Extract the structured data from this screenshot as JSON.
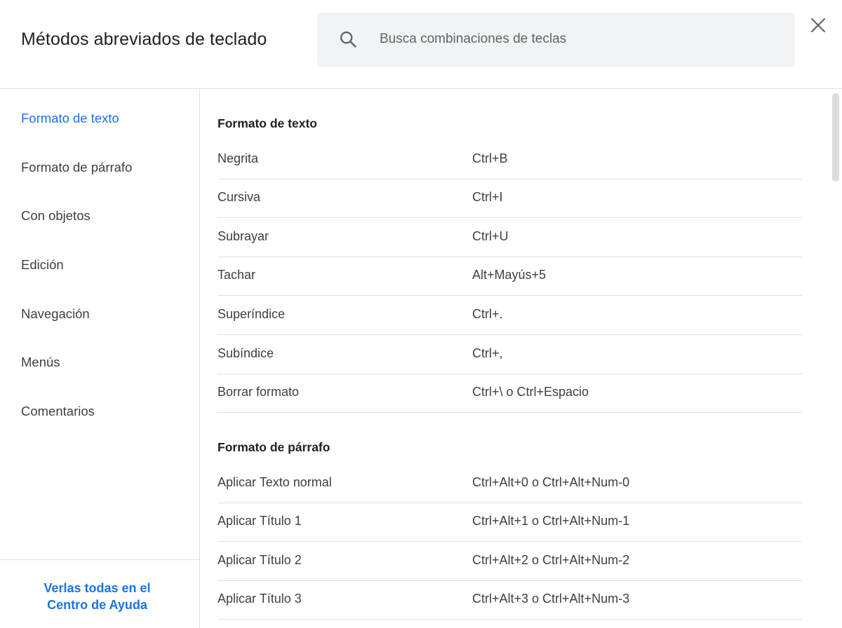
{
  "header": {
    "title": "Métodos abreviados de teclado",
    "search_placeholder": "Busca combinaciones de teclas",
    "search_icon": "search-icon",
    "close_icon": "close-icon"
  },
  "sidebar": {
    "items": [
      {
        "label": "Formato de texto",
        "active": true
      },
      {
        "label": "Formato de párrafo",
        "active": false
      },
      {
        "label": "Con objetos",
        "active": false
      },
      {
        "label": "Edición",
        "active": false
      },
      {
        "label": "Navegación",
        "active": false
      },
      {
        "label": "Menús",
        "active": false
      },
      {
        "label": "Comentarios",
        "active": false
      }
    ],
    "help_link_line1": "Verlas todas en el",
    "help_link_line2": "Centro de Ayuda"
  },
  "sections": [
    {
      "title": "Formato de texto",
      "rows": [
        {
          "action": "Negrita",
          "keys": "Ctrl+B"
        },
        {
          "action": "Cursiva",
          "keys": "Ctrl+I"
        },
        {
          "action": "Subrayar",
          "keys": "Ctrl+U"
        },
        {
          "action": "Tachar",
          "keys": "Alt+Mayús+5"
        },
        {
          "action": "Superíndice",
          "keys": "Ctrl+."
        },
        {
          "action": "Subíndice",
          "keys": "Ctrl+,"
        },
        {
          "action": "Borrar formato",
          "keys": "Ctrl+\\ o Ctrl+Espacio"
        }
      ]
    },
    {
      "title": "Formato de párrafo",
      "rows": [
        {
          "action": "Aplicar Texto normal",
          "keys": "Ctrl+Alt+0 o Ctrl+Alt+Num-0"
        },
        {
          "action": "Aplicar Título 1",
          "keys": "Ctrl+Alt+1 o Ctrl+Alt+Num-1"
        },
        {
          "action": "Aplicar Título 2",
          "keys": "Ctrl+Alt+2 o Ctrl+Alt+Num-2"
        },
        {
          "action": "Aplicar Título 3",
          "keys": "Ctrl+Alt+3 o Ctrl+Alt+Num-3"
        }
      ]
    }
  ],
  "colors": {
    "accent": "#1a73e8",
    "text": "#3c4043",
    "divider": "#e0e0e0",
    "search_bg": "#f1f3f4"
  }
}
